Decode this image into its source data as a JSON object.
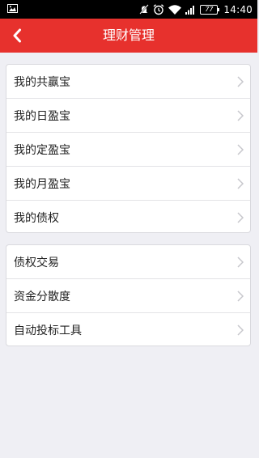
{
  "status_bar": {
    "battery_level": "77",
    "time": "14:40",
    "icons": [
      "image-icon",
      "mute-icon",
      "alarm-icon",
      "wifi-icon",
      "signal-icon",
      "battery-icon"
    ]
  },
  "nav": {
    "title": "理财管理",
    "back_icon": "back-chevron-icon"
  },
  "groups": [
    {
      "items": [
        {
          "label": "我的共赢宝"
        },
        {
          "label": "我的日盈宝"
        },
        {
          "label": "我的定盈宝"
        },
        {
          "label": "我的月盈宝"
        },
        {
          "label": "我的债权"
        }
      ]
    },
    {
      "items": [
        {
          "label": "债权交易"
        },
        {
          "label": "资金分散度"
        },
        {
          "label": "自动投标工具"
        }
      ]
    }
  ],
  "colors": {
    "nav_background": "#e7312d",
    "page_background": "#efeff4",
    "chevron": "#c7c7cc"
  }
}
